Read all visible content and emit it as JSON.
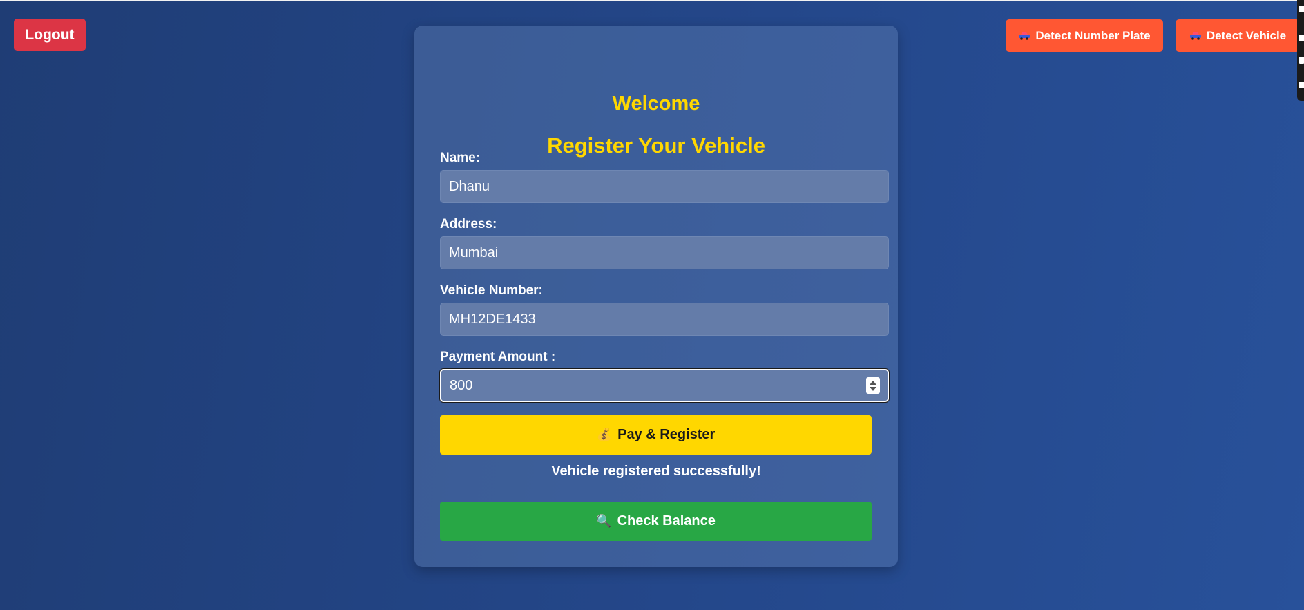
{
  "header": {
    "logout_label": "Logout",
    "detect_plate_label": "Detect Number Plate",
    "detect_vehicle_label": "Detect Vehicle"
  },
  "form": {
    "welcome": "Welcome",
    "title": "Register Your Vehicle",
    "name_label": "Name:",
    "name_value": "Dhanu",
    "address_label": "Address:",
    "address_value": "Mumbai",
    "vehicle_number_label": "Vehicle Number:",
    "vehicle_number_value": "MH12DE1433",
    "payment_label": "Payment Amount :",
    "payment_value": "800",
    "pay_button_label": "Pay & Register",
    "status_message": "Vehicle registered successfully!",
    "check_balance_label": "Check Balance"
  },
  "icons": {
    "pay": "money-bag-icon",
    "check": "magnifier-icon",
    "detect": "car-icon"
  },
  "colors": {
    "logout": "#dc3545",
    "detect": "#ff5733",
    "accent": "#ffd700",
    "check": "#28a745"
  }
}
